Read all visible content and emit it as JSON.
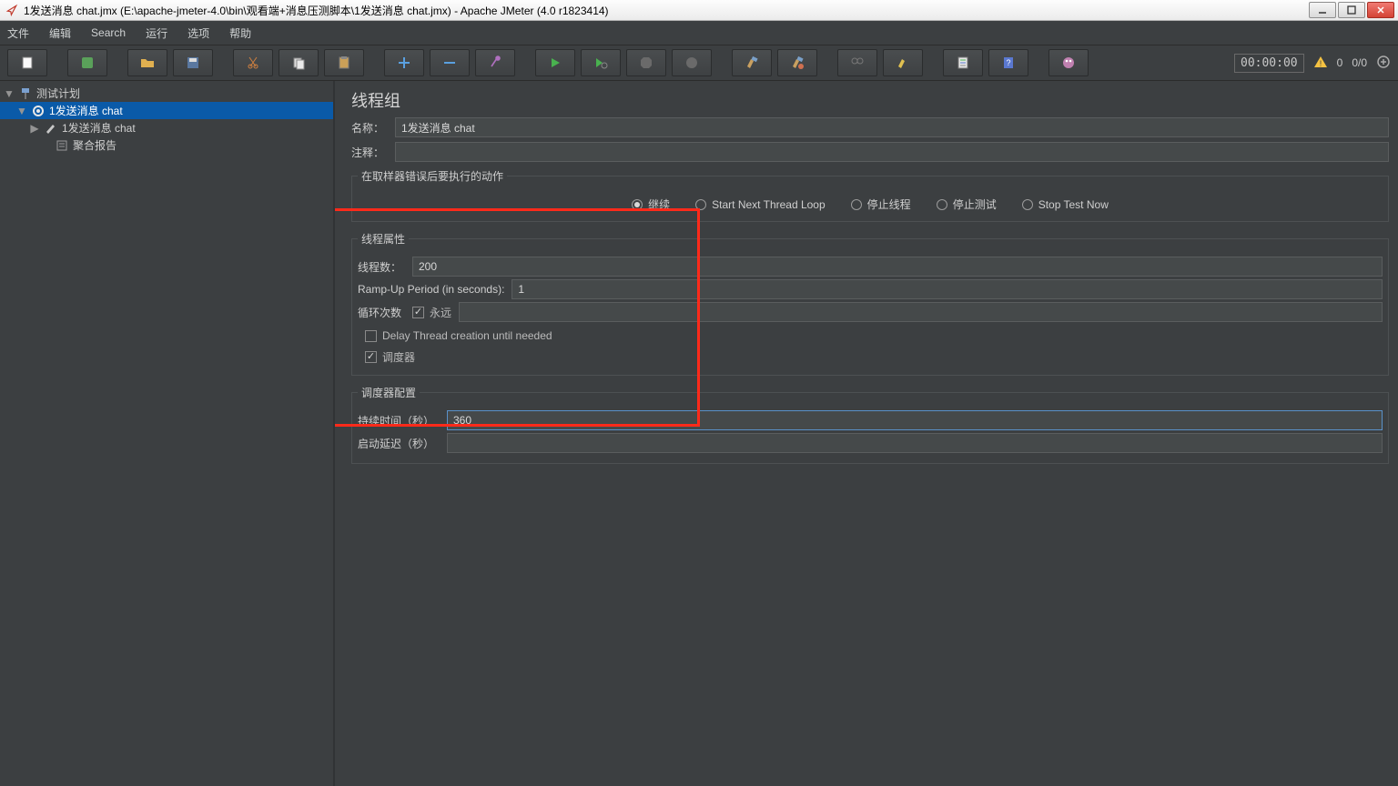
{
  "window": {
    "title": "1发送消息 chat.jmx (E:\\apache-jmeter-4.0\\bin\\观看端+消息压测脚本\\1发送消息 chat.jmx) - Apache JMeter (4.0 r1823414)"
  },
  "menu": {
    "file": "文件",
    "edit": "编辑",
    "search": "Search",
    "run": "运行",
    "options": "选项",
    "help": "帮助"
  },
  "toolbar": {
    "timer": "00:00:00",
    "warn_count": "0",
    "active_threads": "0/0"
  },
  "tree": {
    "root": "测试计划",
    "threadGroup": "1发送消息 chat",
    "sampler": "1发送消息 chat",
    "report": "聚合报告"
  },
  "panel": {
    "title": "线程组",
    "name_label": "名称：",
    "name_value": "1发送消息 chat",
    "comment_label": "注释：",
    "comment_value": "",
    "error_group": "在取样器错误后要执行的动作",
    "radio_continue": "继续",
    "radio_start_next": "Start Next Thread Loop",
    "radio_stop_thread": "停止线程",
    "radio_stop_test": "停止测试",
    "radio_stop_now": "Stop Test Now",
    "thread_props": "线程属性",
    "threads_label": "线程数：",
    "threads_value": "200",
    "ramp_label": "Ramp-Up Period (in seconds):",
    "ramp_value": "1",
    "loop_label": "循环次数",
    "forever_label": "永远",
    "delay_label": "Delay Thread creation until needed",
    "scheduler_label": "调度器",
    "sched_config": "调度器配置",
    "duration_label": "持续时间（秒）",
    "duration_value": "360",
    "startup_label": "启动延迟（秒）",
    "startup_value": ""
  }
}
